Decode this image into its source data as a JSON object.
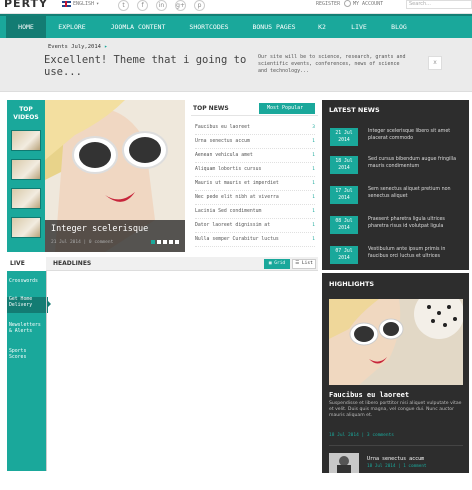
{
  "header": {
    "logo": "PERTY",
    "language": "ENGLISH",
    "social": [
      {
        "icon": "twitter-icon",
        "glyph": "t"
      },
      {
        "icon": "facebook-icon",
        "glyph": "f"
      },
      {
        "icon": "linkedin-icon",
        "glyph": "in"
      },
      {
        "icon": "google-plus-icon",
        "glyph": "g+"
      },
      {
        "icon": "pinterest-icon",
        "glyph": "p"
      }
    ],
    "register": "REGISTER",
    "account": "MY ACCOUNT",
    "search_placeholder": "Search..."
  },
  "nav": {
    "items": [
      "HOME",
      "EXPLORE",
      "JOOMLA CONTENT",
      "SHORTCODES",
      "BONUS PAGES",
      "K2",
      "LIVE",
      "BLOG"
    ],
    "active": "HOME"
  },
  "events": {
    "label": "Events July,2014",
    "quote": "Excellent! Theme that i going to use...",
    "text": "Our site will be to science, research, grants and scientific events, conferences, news of science and technology...",
    "close": "x"
  },
  "top_videos": {
    "title": "TOP VIDEOS"
  },
  "hero": {
    "title": "Integer scelerisque",
    "meta": "21 Jul 2014 | 0 comment"
  },
  "top_news": {
    "title": "TOP NEWS",
    "button": "Most Popular",
    "items": [
      {
        "text": "Faucibus eu laoreet",
        "count": "3"
      },
      {
        "text": "Urna senectus accum",
        "count": "1"
      },
      {
        "text": "Aenean vehicula amet",
        "count": "1"
      },
      {
        "text": "Aliquam lobortis cursus",
        "count": "1"
      },
      {
        "text": "Mauris ut mauris et imperdiet",
        "count": "1"
      },
      {
        "text": "Nec pede elit nibh at viverra",
        "count": "1"
      },
      {
        "text": "Lacinia Sed condimentum",
        "count": "1"
      },
      {
        "text": "Dator laoreet dignissim at",
        "count": "1"
      },
      {
        "text": "Nulla semper Curabitur luctus",
        "count": "1"
      }
    ]
  },
  "latest_news": {
    "title": "LATEST NEWS",
    "items": [
      {
        "date": "21 Jul 2014",
        "text": "Integer scelerisque libero sit amet placerat commodo"
      },
      {
        "date": "18 Jul 2014",
        "text": "Sed cursus bibendum augue fringilla mauris condimentum"
      },
      {
        "date": "17 Jul 2014",
        "text": "Sem senectus aliquet pretium non senectus aliquet"
      },
      {
        "date": "08 Jul 2014",
        "text": "Praesent pharetra ligula ultrices pharetra risus id volutpat ligula"
      },
      {
        "date": "07 Jul 2014",
        "text": "Vestibulum ante ipsum primis in faucibus orci luctus et ultrices"
      }
    ]
  },
  "headlines": {
    "live": "LIVE",
    "title": "HEADLINES",
    "grid": "Grid",
    "list": "List"
  },
  "live_menu": [
    {
      "label": "Crosswords",
      "selected": false
    },
    {
      "label": "Get Home Delivery",
      "selected": true
    },
    {
      "label": "Newsletters & Alerts",
      "selected": false
    },
    {
      "label": "Sports Scores",
      "selected": false
    }
  ],
  "highlights": {
    "title": "HIGHLIGHTS",
    "main_title": "Faucibus eu laoreet",
    "main_text": "Suspendisse et libero porttitor nisi aliquet vulputate vitae et velit. Duis quis magna, vel congue dui. Nunc auctor mauris aliquam et.",
    "main_meta": "18 Jul 2014 | 3 comments",
    "small_title": "Urna senectus accum",
    "small_meta": "18 Jul 2014 | 1 comment"
  },
  "colors": {
    "accent": "#1aa89b",
    "accent_dark": "#137c73",
    "panel_dark": "#2d2d2d"
  }
}
